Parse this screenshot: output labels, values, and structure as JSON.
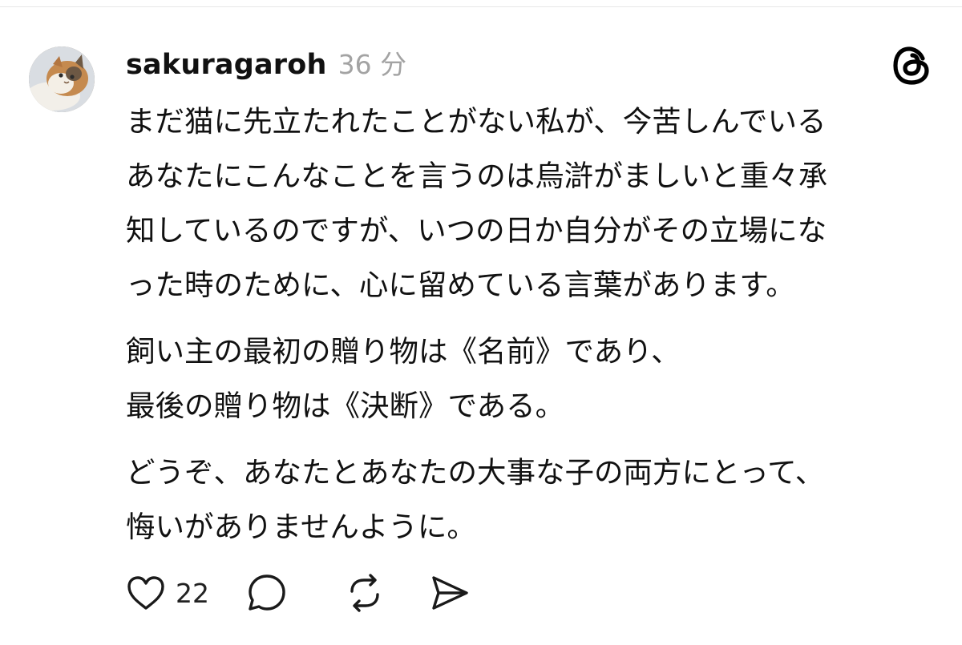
{
  "post": {
    "username": "sakuragaroh",
    "timestamp": "36 分",
    "paragraphs": [
      {
        "lines": [
          "まだ猫に先立たれたことがない私が、今苦しんでいる",
          "あなたにこんなことを言うのは烏滸がましいと重々承",
          "知しているのですが、いつの日か自分がその立場にな",
          "った時のために、心に留めている言葉があります。"
        ]
      },
      {
        "lines": [
          "飼い主の最初の贈り物は《名前》であり、",
          "最後の贈り物は《決断》である。"
        ]
      },
      {
        "lines": [
          "どうぞ、あなたとあなたの大事な子の両方にとって、",
          "悔いがありませんように。"
        ]
      }
    ],
    "actions": {
      "like_count": "22"
    }
  },
  "icons": {
    "avatar": "cat-avatar",
    "threads": "threads-logo-icon",
    "like": "heart-icon",
    "reply": "comment-bubble-icon",
    "repost": "repost-icon",
    "share": "send-icon"
  },
  "colors": {
    "text": "#111111",
    "muted": "#a3a3a3",
    "divider": "#e6e6e6"
  }
}
